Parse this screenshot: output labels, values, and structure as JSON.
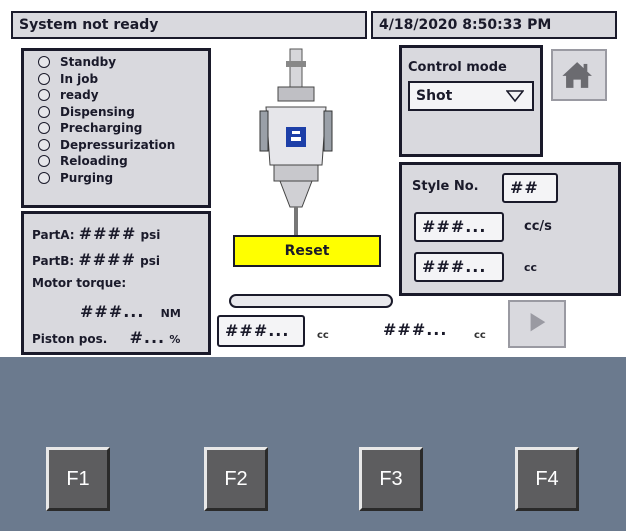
{
  "header": {
    "status": "System not ready",
    "datetime": "4/18/2020 8:50:33 PM"
  },
  "states": [
    {
      "label": "Standby"
    },
    {
      "label": "In job"
    },
    {
      "label": "ready"
    },
    {
      "label": "Dispensing"
    },
    {
      "label": "Precharging"
    },
    {
      "label": "Depressurization"
    },
    {
      "label": "Reloading"
    },
    {
      "label": "Purging"
    }
  ],
  "pressures": {
    "partA_label": "PartA:",
    "partA_value": "####",
    "partA_unit": "psi",
    "partB_label": "PartB:",
    "partB_value": "####",
    "partB_unit": "psi",
    "torque_label": "Motor torque:",
    "torque_value": "###...",
    "torque_unit": "NM",
    "piston_label": "Piston pos.",
    "piston_value": "#...",
    "piston_unit": "%"
  },
  "center": {
    "reset_label": "Reset",
    "volume1_value": "###...",
    "volume1_unit": "cc",
    "volume2_value": "###...",
    "volume2_unit": "cc"
  },
  "control": {
    "title": "Control mode",
    "selected": "Shot"
  },
  "style": {
    "label": "Style No.",
    "value": "##",
    "flow_value": "###...",
    "flow_unit": "cc/s",
    "vol_value": "###...",
    "vol_unit": "cc"
  },
  "icons": {
    "home": "home-icon",
    "play": "play-icon",
    "caret": "chevron-down-icon"
  },
  "fkeys": [
    "F1",
    "F2",
    "F3",
    "F4"
  ]
}
